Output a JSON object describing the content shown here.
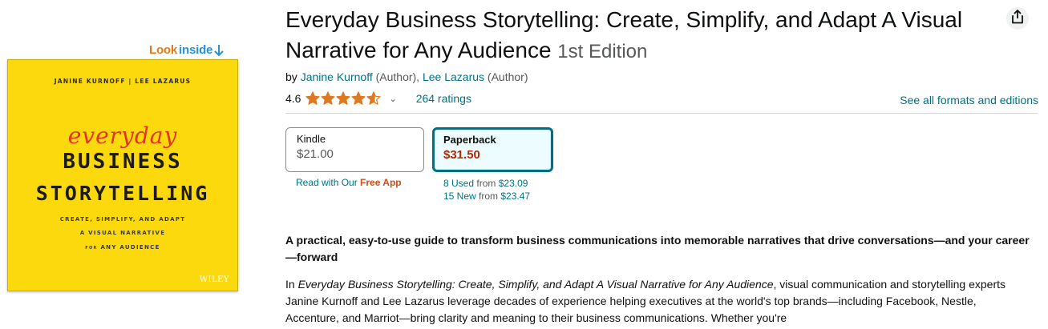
{
  "look_inside": {
    "part1": "Look",
    "part2": "inside",
    "arrow_icon": "down-arrow-icon"
  },
  "cover": {
    "authors": "JANINE KURNOFF  |  LEE LAZARUS",
    "word1": "everyday",
    "word2": "BUSINESS",
    "word3": "STORYTELLING",
    "line1": "CREATE, SIMPLIFY, AND ADAPT",
    "line2": "A VISUAL NARRATIVE",
    "line3a": "FOR",
    "line3b": "ANY AUDIENCE",
    "publisher": "WILEY",
    "colors": {
      "background": "#fcd90d",
      "script": "#e2331d",
      "text": "#1b1b1b"
    }
  },
  "product": {
    "title": "Everyday Business Storytelling: Create, Simplify, and Adapt A Visual Narrative for Any Audience",
    "edition": "1st Edition",
    "share_icon": "share-icon",
    "byline": {
      "by": "by",
      "author1": "Janine Kurnoff",
      "author1_role": "(Author),",
      "author2": "Lee Lazarus",
      "author2_role": "(Author)"
    },
    "rating": {
      "value": "4.6",
      "stars": 4.6,
      "count_text": "264 ratings",
      "chevron": "⌄"
    },
    "formats_link": "See all formats and editions"
  },
  "formats": {
    "kindle": {
      "label": "Kindle",
      "price": "$21.00",
      "sub_prefix": "Read with Our",
      "sub_free": "Free App"
    },
    "paperback": {
      "label": "Paperback",
      "price": "$31.50",
      "used_link": "8 Used",
      "used_from": "from",
      "used_price": "$23.09",
      "new_link": "15 New",
      "new_from": "from",
      "new_price": "$23.47",
      "selected": true
    }
  },
  "description": {
    "headline": "A practical, easy-to-use guide to transform business communications into memorable narratives that drive conversations—and your career—forward",
    "intro": "In",
    "book_italic": "Everyday Business Storytelling: Create, Simplify, and Adapt A Visual Narrative for Any Audience",
    "body": ", visual communication and storytelling experts Janine Kurnoff and Lee Lazarus leverage decades of experience helping executives at the world's top brands—including Facebook, Nestle, Accenture, and Marriot—bring clarity and meaning to their business communications. Whether you're"
  },
  "colors": {
    "link": "#007185",
    "price": "#b12704",
    "star": "#de7921",
    "look_inside_orange": "#e47911"
  }
}
